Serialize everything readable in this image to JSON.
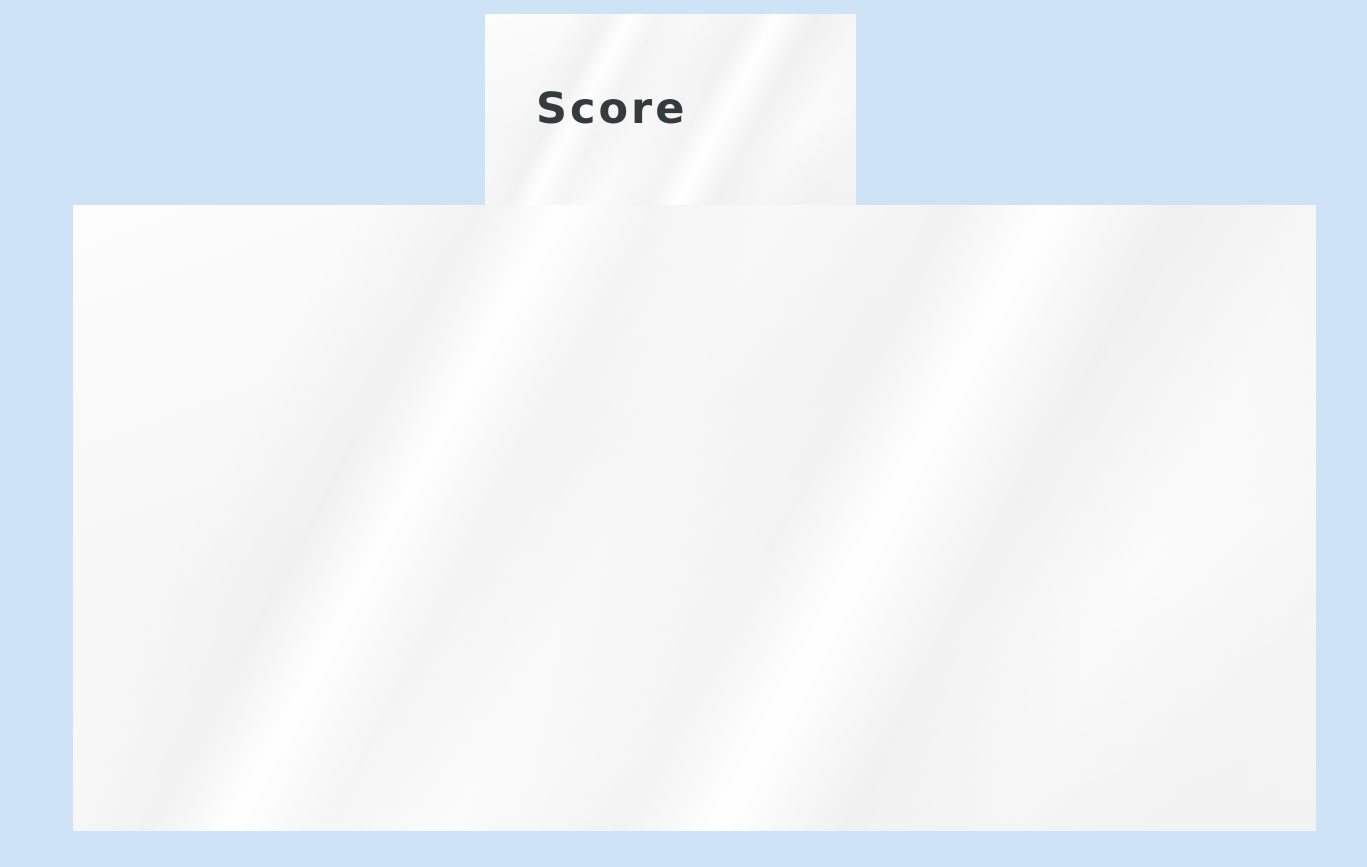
{
  "score_panel": {
    "label": "Score"
  },
  "colors": {
    "page_background": "#cfe3f6",
    "panel_background": "#f8f8f8",
    "label_text": "#333b3b"
  }
}
